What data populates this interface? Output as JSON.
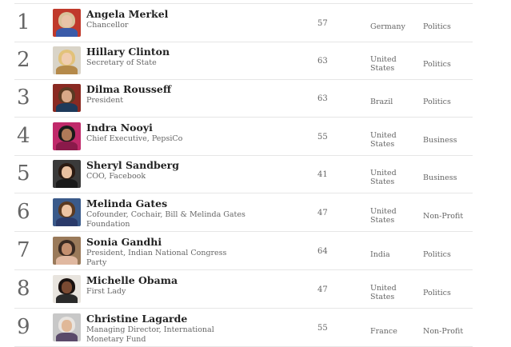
{
  "rows": [
    {
      "rank": "1",
      "name": "Angela Merkel",
      "title": "Chancellor",
      "age": "57",
      "country": "Germany",
      "category": "Politics",
      "photo_colors": {
        "bg": "#c0392b",
        "hair": "#d8c29a",
        "face": "#e8c4a8",
        "body": "#3a5aa8"
      }
    },
    {
      "rank": "2",
      "name": "Hillary Clinton",
      "title": "Secretary of State",
      "age": "63",
      "country": "United States",
      "category": "Politics",
      "photo_colors": {
        "bg": "#d9d4c8",
        "hair": "#e2c27a",
        "face": "#f0cdb0",
        "body": "#b58a4a"
      }
    },
    {
      "rank": "3",
      "name": "Dilma Rousseff",
      "title": "President",
      "age": "63",
      "country": "Brazil",
      "category": "Politics",
      "photo_colors": {
        "bg": "#8a2a22",
        "hair": "#5a3a22",
        "face": "#d8a888",
        "body": "#1e3a5a"
      }
    },
    {
      "rank": "4",
      "name": "Indra Nooyi",
      "title": "Chief Executive, PepsiCo",
      "age": "55",
      "country": "United States",
      "category": "Business",
      "photo_colors": {
        "bg": "#c0296a",
        "hair": "#1a1a1a",
        "face": "#b07a58",
        "body": "#8a1a4a"
      }
    },
    {
      "rank": "5",
      "name": "Sheryl Sandberg",
      "title": "COO, Facebook",
      "age": "41",
      "country": "United States",
      "category": "Business",
      "photo_colors": {
        "bg": "#3a3a3a",
        "hair": "#2a1a12",
        "face": "#e8c0a0",
        "body": "#1a1a1a"
      }
    },
    {
      "rank": "6",
      "name": "Melinda Gates",
      "title": "Cofounder, Cochair, Bill & Melinda Gates Foundation",
      "age": "47",
      "country": "United States",
      "category": "Non-Profit",
      "photo_colors": {
        "bg": "#3a5a8a",
        "hair": "#5a3a22",
        "face": "#ecc4a4",
        "body": "#2a3a6a"
      }
    },
    {
      "rank": "7",
      "name": "Sonia Gandhi",
      "title": "President, Indian National Congress Party",
      "age": "64",
      "country": "India",
      "category": "Politics",
      "photo_colors": {
        "bg": "#9a7a5a",
        "hair": "#3a2a22",
        "face": "#c49070",
        "body": "#e0b8a0"
      }
    },
    {
      "rank": "8",
      "name": "Michelle Obama",
      "title": "First Lady",
      "age": "47",
      "country": "United States",
      "category": "Politics",
      "photo_colors": {
        "bg": "#e8e4de",
        "hair": "#1a1210",
        "face": "#7a4a32",
        "body": "#2a2a2a"
      }
    },
    {
      "rank": "9",
      "name": "Christine Lagarde",
      "title": "Managing Director, International Monetary Fund",
      "age": "55",
      "country": "France",
      "category": "Non-Profit",
      "photo_colors": {
        "bg": "#c8c8c8",
        "hair": "#e8e4e0",
        "face": "#e0b898",
        "body": "#5a4a6a"
      }
    }
  ]
}
